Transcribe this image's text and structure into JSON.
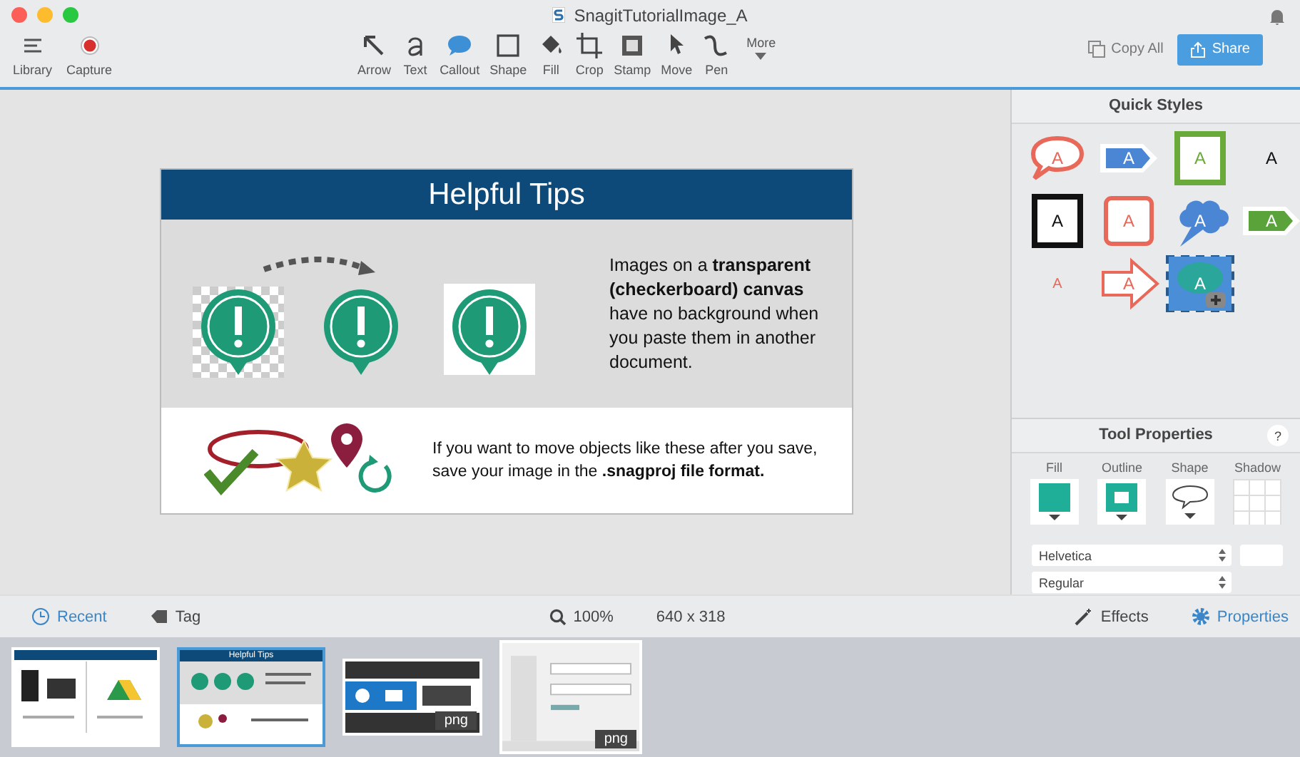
{
  "window": {
    "title": "SnagitTutorialImage_A"
  },
  "toolbar": {
    "left": [
      {
        "label": "Library"
      },
      {
        "label": "Capture"
      }
    ],
    "tools": [
      {
        "label": "Arrow"
      },
      {
        "label": "Text"
      },
      {
        "label": "Callout"
      },
      {
        "label": "Shape"
      },
      {
        "label": "Fill"
      },
      {
        "label": "Crop"
      },
      {
        "label": "Stamp"
      },
      {
        "label": "Move"
      },
      {
        "label": "Pen"
      }
    ],
    "more": "More",
    "copy_all": "Copy All",
    "share": "Share"
  },
  "canvas": {
    "title": "Helpful Tips",
    "tip_1": "Images on a **transparent (checkerboard) canvas** have no background when you paste them in another document.",
    "tip_2": "If you want to move objects like these after you save, save your image in the **.snagproj file format.**"
  },
  "quick_styles": {
    "title": "Quick Styles",
    "items": [
      {
        "kind": "bubble",
        "label": "A",
        "color": "#e8685a",
        "selected": false
      },
      {
        "kind": "arrow",
        "label": "A",
        "color": "#4a86d4",
        "selected": false
      },
      {
        "kind": "box",
        "label": "A",
        "color": "#6aaa3a",
        "selected": false
      },
      {
        "kind": "plain",
        "label": "A",
        "color": "#111111",
        "selected": false
      },
      {
        "kind": "box",
        "label": "A",
        "color": "#111111",
        "selected": false
      },
      {
        "kind": "rounded",
        "label": "A",
        "color": "#e8685a",
        "selected": false
      },
      {
        "kind": "cloud",
        "label": "A",
        "color": "#4a86d4",
        "selected": false
      },
      {
        "kind": "arrow",
        "label": "A",
        "color": "#5aa33a",
        "selected": false
      },
      {
        "kind": "plain",
        "label": "A",
        "color": "#e8685a",
        "selected": false
      },
      {
        "kind": "outline-arrow",
        "label": "A",
        "color": "#e8685a",
        "selected": false
      },
      {
        "kind": "bubble-fill",
        "label": "A",
        "color": "#2aa69a",
        "selected": true
      }
    ]
  },
  "tool_properties": {
    "title": "Tool Properties",
    "help": "?",
    "swatches": [
      {
        "label": "Fill",
        "kind": "fill"
      },
      {
        "label": "Outline",
        "kind": "outline"
      },
      {
        "label": "Shape",
        "kind": "shape"
      },
      {
        "label": "Shadow",
        "kind": "shadow"
      }
    ],
    "font": "Helvetica",
    "style": "Regular"
  },
  "bottom_bar": {
    "recent": "Recent",
    "tag": "Tag",
    "zoom": "100%",
    "size": "640 x 318",
    "effects": "Effects",
    "properties": "Properties"
  },
  "tray": [
    {
      "kind": "doc",
      "selected": false
    },
    {
      "kind": "tips",
      "title": "Helpful Tips",
      "selected": true
    },
    {
      "kind": "bar",
      "badge": "png",
      "selected": false
    },
    {
      "kind": "panel",
      "badge": "png",
      "selected": false
    }
  ]
}
